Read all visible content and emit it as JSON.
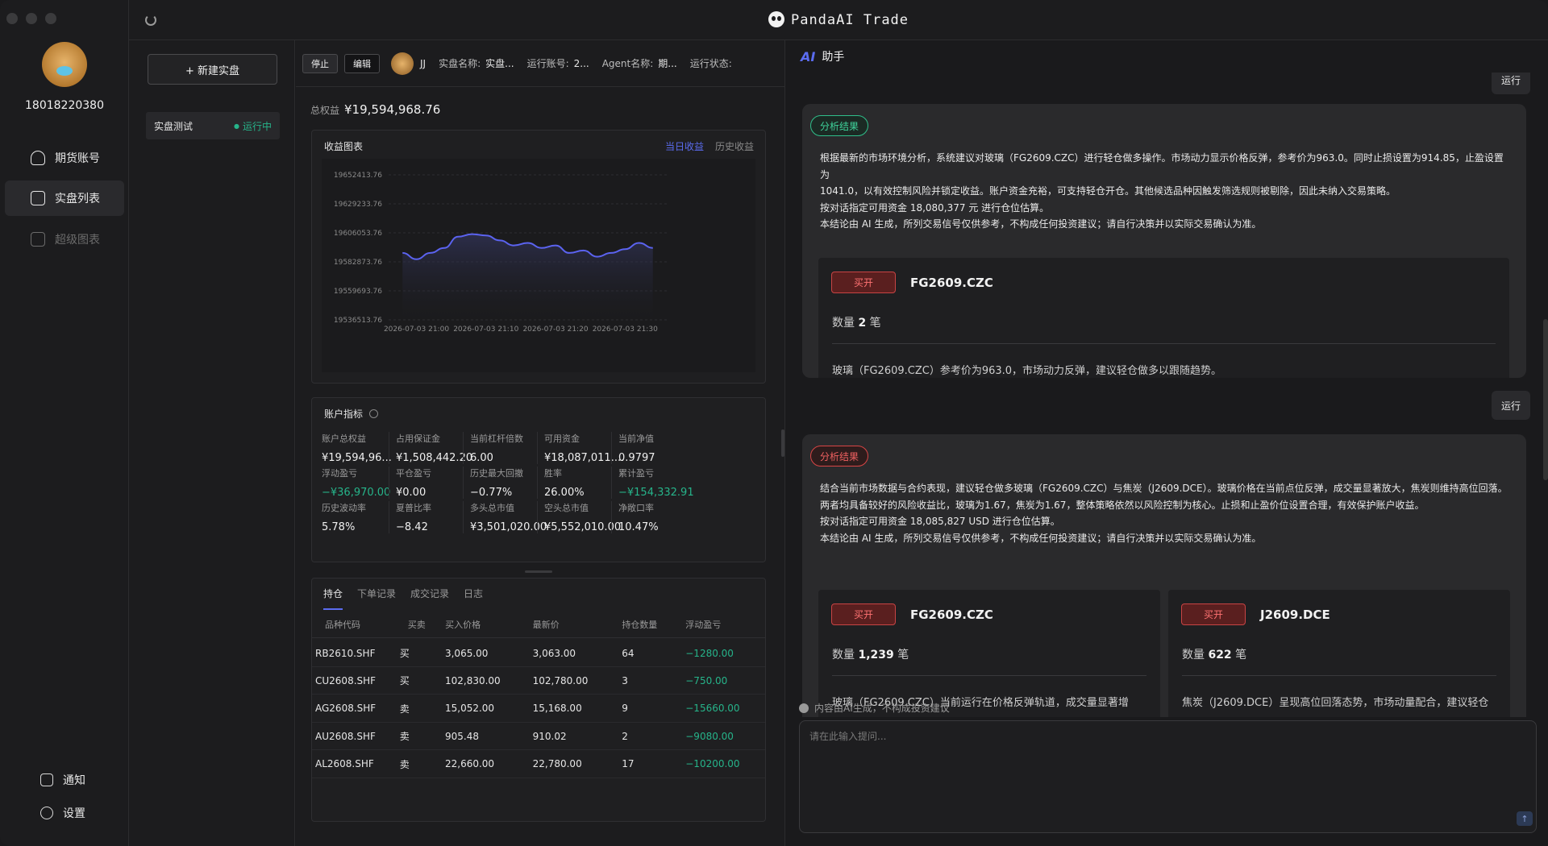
{
  "app": {
    "title": "PandaAI Trade"
  },
  "user": {
    "id": "18018220380"
  },
  "nav": {
    "items": [
      {
        "label": "期货账号",
        "icon": "user-icon"
      },
      {
        "label": "实盘列表",
        "icon": "list-icon"
      },
      {
        "label": "超级图表",
        "icon": "chart-icon"
      }
    ],
    "bottom": [
      {
        "label": "通知",
        "icon": "bell-icon"
      },
      {
        "label": "设置",
        "icon": "gear-icon"
      }
    ]
  },
  "list": {
    "new_button": "+ 新建实盘",
    "items": [
      {
        "name": "实盘测试",
        "status": "运行中"
      }
    ]
  },
  "toolbar": {
    "stop": "停止",
    "edit": "编辑",
    "agent_user": "JJ",
    "fields": [
      {
        "label": "实盘名称:",
        "value": "实盘..."
      },
      {
        "label": "运行账号:",
        "value": "2..."
      },
      {
        "label": "Agent名称:",
        "value": "期..."
      },
      {
        "label": "运行状态:",
        "value": ""
      }
    ]
  },
  "total": {
    "label": "总权益",
    "value": "¥19,594,968.76"
  },
  "chart_panel": {
    "title": "收益图表",
    "tab_today": "当日收益",
    "tab_history": "历史收益"
  },
  "chart_data": {
    "type": "area",
    "title": "",
    "xlabel": "",
    "ylabel": "",
    "y_ticks": [
      "19652413.76",
      "19629233.76",
      "19606053.76",
      "19582873.76",
      "19559693.76",
      "19536513.76"
    ],
    "x_ticks": [
      "2026-07-03 21:00",
      "2026-07-03 21:10",
      "2026-07-03 21:20",
      "2026-07-03 21:30"
    ],
    "ylim": [
      19536513.76,
      19652413.76
    ],
    "x_minutes": [
      -2,
      0,
      2,
      4,
      6,
      8,
      10,
      12,
      14,
      16,
      18,
      20,
      22,
      24,
      26,
      28,
      30,
      32,
      34
    ],
    "values": [
      19590000,
      19585000,
      19590000,
      19594000,
      19603000,
      19605000,
      19604000,
      19600000,
      19596000,
      19598000,
      19594000,
      19596000,
      19590000,
      19592000,
      19587000,
      19590000,
      19593000,
      19598000,
      19594000
    ],
    "color": "#5b63f0",
    "grid": true
  },
  "metrics_panel": {
    "title": "账户指标",
    "rows": [
      [
        {
          "k": "账户总权益",
          "v": "¥19,594,96..."
        },
        {
          "k": "占用保证金",
          "v": "¥1,508,442.20"
        },
        {
          "k": "当前杠杆倍数",
          "v": "6.00"
        },
        {
          "k": "可用资金",
          "v": "¥18,087,011...."
        },
        {
          "k": "当前净值",
          "v": "0.9797"
        }
      ],
      [
        {
          "k": "浮动盈亏",
          "v": "−¥36,970.00",
          "teal": true
        },
        {
          "k": "平仓盈亏",
          "v": "¥0.00"
        },
        {
          "k": "历史最大回撤",
          "v": "−0.77%"
        },
        {
          "k": "胜率",
          "v": "26.00%"
        },
        {
          "k": "累计盈亏",
          "v": "−¥154,332.91",
          "teal": true
        }
      ],
      [
        {
          "k": "历史波动率",
          "v": "5.78%"
        },
        {
          "k": "夏普比率",
          "v": "−8.42"
        },
        {
          "k": "多头总市值",
          "v": "¥3,501,020.00"
        },
        {
          "k": "空头总市值",
          "v": "¥5,552,010.00"
        },
        {
          "k": "净敞口率",
          "v": "10.47%"
        }
      ]
    ]
  },
  "positions": {
    "tabs": [
      "持仓",
      "下单记录",
      "成交记录",
      "日志"
    ],
    "headers": [
      "品种代码",
      "买卖",
      "买入价格",
      "最新价",
      "持仓数量",
      "浮动盈亏"
    ],
    "rows": [
      [
        "RB2610.SHF",
        "买",
        "3,065.00",
        "3,063.00",
        "64",
        "−1280.00"
      ],
      [
        "CU2608.SHF",
        "买",
        "102,830.00",
        "102,780.00",
        "3",
        "−750.00"
      ],
      [
        "AG2608.SHF",
        "卖",
        "15,052.00",
        "15,168.00",
        "9",
        "−15660.00"
      ],
      [
        "AU2608.SHF",
        "卖",
        "905.48",
        "910.02",
        "2",
        "−9080.00"
      ],
      [
        "AL2608.SHF",
        "卖",
        "22,660.00",
        "22,780.00",
        "17",
        "−10200.00"
      ]
    ]
  },
  "assistant": {
    "title": "助手",
    "run_label": "运行",
    "card1": {
      "badge": "分析结果",
      "lines": [
        "根据最新的市场环境分析，系统建议对玻璃（FG2609.CZC）进行轻仓做多操作。市场动力显示价格反弹，参考价为963.0。同时止损设置为914.85，止盈设置为",
        "1041.0，以有效控制风险并锁定收益。账户资金充裕，可支持轻仓开仓。其他候选品种因触发筛选规则被剔除，因此未纳入交易策略。",
        "按对话指定可用资金 18,080,377 元 进行仓位估算。",
        "本结论由 AI 生成，所列交易信号仅供参考，不构成任何投资建议；请自行决策并以实际交易确认为准。"
      ],
      "signals": [
        {
          "tag": "买开",
          "code": "FG2609.CZC",
          "qty_label": "数量",
          "qty": "2",
          "qty_unit": "笔",
          "desc": "玻璃（FG2609.CZC）参考价为963.0，市场动力反弹，建议轻仓做多以跟随趋势。"
        }
      ]
    },
    "card2": {
      "badge": "分析结果",
      "lines": [
        "结合当前市场数据与合约表现，建议轻仓做多玻璃（FG2609.CZC）与焦炭（J2609.DCE）。玻璃价格在当前点位反弹，成交量显著放大，焦炭则维持高位回落。",
        "两者均具备较好的风险收益比，玻璃为1.67，焦炭为1.67，整体策略依然以风险控制为核心。止损和止盈价位设置合理，有效保护账户收益。",
        "按对话指定可用资金 18,085,827 USD 进行仓位估算。",
        "本结论由 AI 生成，所列交易信号仅供参考，不构成任何投资建议；请自行决策并以实际交易确认为准。"
      ],
      "signals": [
        {
          "tag": "买开",
          "code": "FG2609.CZC",
          "qty_label": "数量",
          "qty": "1,239",
          "qty_unit": "笔",
          "desc": "玻璃（FG2609.CZC）当前运行在价格反弹轨道，成交量显著增"
        },
        {
          "tag": "买开",
          "code": "J2609.DCE",
          "qty_label": "数量",
          "qty": "622",
          "qty_unit": "笔",
          "desc": "焦炭（J2609.DCE）呈现高位回落态势，市场动量配合，建议轻仓"
        }
      ]
    },
    "disclaimer": "内容由AI生成，不构成投资建议",
    "input_placeholder": "请在此输入提问..."
  }
}
